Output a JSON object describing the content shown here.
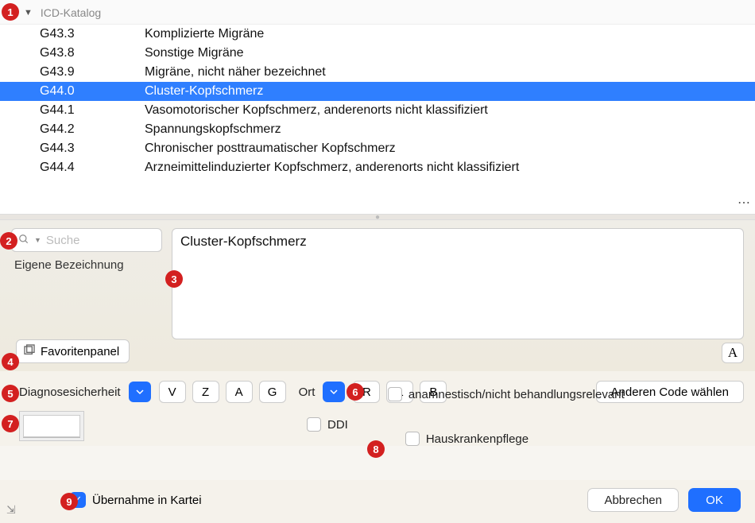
{
  "title": "ICD-Katalog",
  "list": [
    {
      "code": "G43.3",
      "desc": "Komplizierte Migräne",
      "selected": false
    },
    {
      "code": "G43.8",
      "desc": "Sonstige Migräne",
      "selected": false
    },
    {
      "code": "G43.9",
      "desc": "Migräne, nicht näher bezeichnet",
      "selected": false
    },
    {
      "code": "G44.0",
      "desc": "Cluster-Kopfschmerz",
      "selected": true
    },
    {
      "code": "G44.1",
      "desc": "Vasomotorischer Kopfschmerz, anderenorts nicht klassifiziert",
      "selected": false
    },
    {
      "code": "G44.2",
      "desc": "Spannungskopfschmerz",
      "selected": false
    },
    {
      "code": "G44.3",
      "desc": "Chronischer posttraumatischer Kopfschmerz",
      "selected": false
    },
    {
      "code": "G44.4",
      "desc": "Arzneimittelinduzierter Kopfschmerz, anderenorts nicht klassifiziert",
      "selected": false
    }
  ],
  "search": {
    "placeholder": "Suche"
  },
  "own_label": "Eigene Bezeichnung",
  "main_text": "Cluster-Kopfschmerz",
  "favorites_label": "Favoritenpanel",
  "diag": {
    "label": "Diagnosesicherheit",
    "buttons": [
      "V",
      "Z",
      "A",
      "G"
    ]
  },
  "ort": {
    "label": "Ort",
    "buttons": [
      "R",
      "L",
      "B"
    ]
  },
  "other_code_label": "Anderen Code wählen",
  "checks": {
    "ddi": "DDI",
    "anam": "anamnestisch/nicht behandlungsrelevant",
    "hkp": "Hauskrankenpflege"
  },
  "footer": {
    "take_label": "Übernahme in Kartei",
    "cancel": "Abbrechen",
    "ok": "OK"
  },
  "markers": [
    "1",
    "2",
    "3",
    "4",
    "5",
    "6",
    "7",
    "8",
    "9"
  ]
}
